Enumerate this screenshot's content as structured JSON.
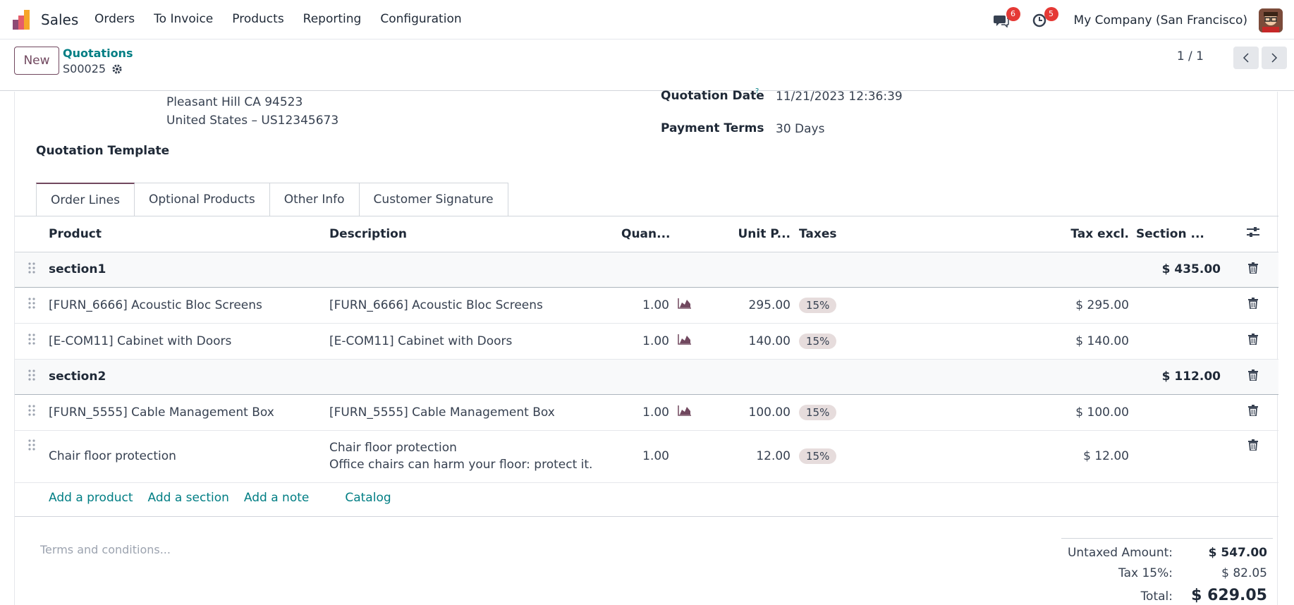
{
  "nav": {
    "app_name": "Sales",
    "menu": [
      "Orders",
      "To Invoice",
      "Products",
      "Reporting",
      "Configuration"
    ],
    "messages_badge": "6",
    "activities_badge": "5",
    "company": "My Company (San Francisco)"
  },
  "control_panel": {
    "new_label": "New",
    "breadcrumb_parent": "Quotations",
    "record_name": "S00025",
    "pager": "1 / 1"
  },
  "form": {
    "address_line1": "Pleasant Hill CA 94523",
    "address_line2": "United States – US12345673",
    "quotation_template_label": "Quotation Template",
    "quotation_date_label": "Quotation Date",
    "quotation_date_help": "?",
    "quotation_date_value": "11/21/2023 12:36:39",
    "payment_terms_label": "Payment Terms",
    "payment_terms_value": "30 Days"
  },
  "tabs": [
    "Order Lines",
    "Optional Products",
    "Other Info",
    "Customer Signature"
  ],
  "table": {
    "headers": {
      "product": "Product",
      "description": "Description",
      "quantity": "Quan...",
      "unit_price": "Unit P...",
      "taxes": "Taxes",
      "tax_excl": "Tax excl.",
      "section": "Section ..."
    },
    "rows": [
      {
        "type": "section",
        "name": "section1",
        "total": "$ 435.00"
      },
      {
        "type": "line",
        "product": "[FURN_6666] Acoustic Bloc Screens",
        "description": "[FURN_6666] Acoustic Bloc Screens",
        "desc2": "",
        "qty": "1.00",
        "chart": true,
        "price": "295.00",
        "tax": "15%",
        "subtotal": "$ 295.00"
      },
      {
        "type": "line",
        "product": "[E-COM11] Cabinet with Doors",
        "description": "[E-COM11] Cabinet with Doors",
        "desc2": "",
        "qty": "1.00",
        "chart": true,
        "price": "140.00",
        "tax": "15%",
        "subtotal": "$ 140.00"
      },
      {
        "type": "section",
        "name": "section2",
        "total": "$ 112.00"
      },
      {
        "type": "line",
        "product": "[FURN_5555] Cable Management Box",
        "description": "[FURN_5555] Cable Management Box",
        "desc2": "",
        "qty": "1.00",
        "chart": true,
        "price": "100.00",
        "tax": "15%",
        "subtotal": "$ 100.00"
      },
      {
        "type": "line",
        "product": "Chair floor protection",
        "description": "Chair floor protection",
        "desc2": "Office chairs can harm your floor: protect it.",
        "qty": "1.00",
        "chart": false,
        "price": "12.00",
        "tax": "15%",
        "subtotal": "$ 12.00"
      }
    ]
  },
  "actions": {
    "add_product": "Add a product",
    "add_section": "Add a section",
    "add_note": "Add a note",
    "catalog": "Catalog"
  },
  "footer": {
    "terms_placeholder": "Terms and conditions...",
    "untaxed_label": "Untaxed Amount:",
    "untaxed_value": "$ 547.00",
    "tax_label": "Tax 15%:",
    "tax_value": "$ 82.05",
    "total_label": "Total:",
    "total_value": "$ 629.05"
  },
  "colors": {
    "brand": "#71485f",
    "link": "#017e84",
    "badge": "#e53935"
  }
}
